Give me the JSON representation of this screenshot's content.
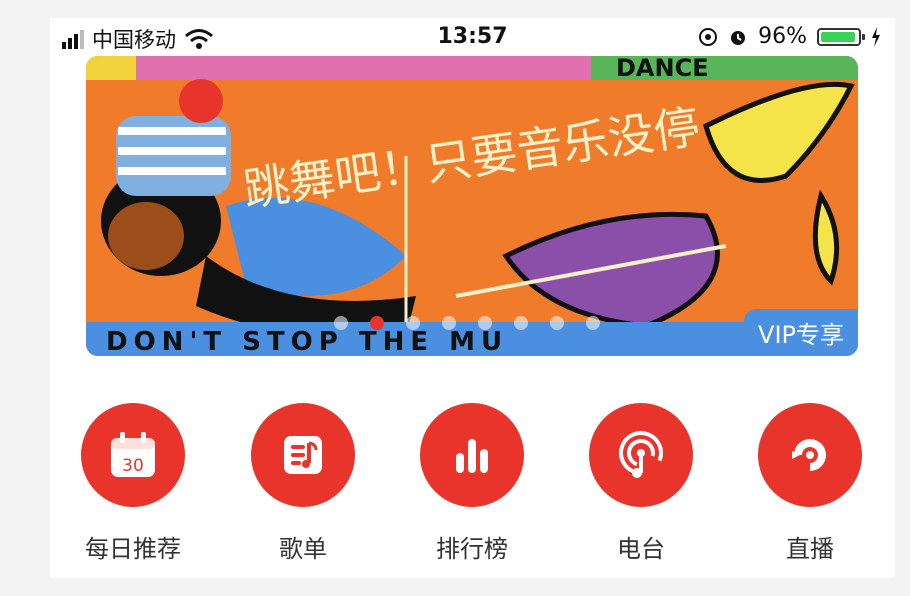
{
  "status_bar": {
    "carrier": "中国移动",
    "time": "13:57",
    "battery": "96%",
    "battery_level": 0.96
  },
  "banner": {
    "badge": "VIP专享",
    "artwork_text_top": "DANCE",
    "artwork_text_bottom": "DON'T STOP THE MU",
    "artwork_title": "跳舞吧！只要音乐没停",
    "slide_count": 8,
    "active_slide": 2
  },
  "nav": {
    "items": [
      {
        "label": "每日推荐",
        "icon": "calendar-icon",
        "icon_text": "30"
      },
      {
        "label": "歌单",
        "icon": "playlist-icon"
      },
      {
        "label": "排行榜",
        "icon": "chart-icon"
      },
      {
        "label": "电台",
        "icon": "radio-icon"
      },
      {
        "label": "直播",
        "icon": "live-icon"
      }
    ]
  },
  "colors": {
    "accent": "#e8342a",
    "banner_orange": "#f07b2a",
    "vip_blue": "#4a8fe0"
  }
}
